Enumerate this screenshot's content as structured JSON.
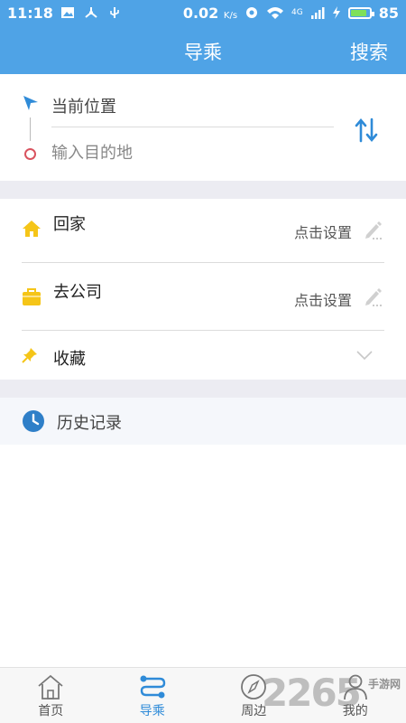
{
  "status_bar": {
    "time": "11:18",
    "speed": "0.02",
    "speed_unit": "K/s",
    "network": "4G",
    "battery": "85",
    "battery_level": 0.85,
    "battery_color": "#7ee05a"
  },
  "nav": {
    "title": "导乘",
    "search_label": "搜索",
    "color": "#4fa3e6"
  },
  "route": {
    "start_label": "当前位置",
    "destination_placeholder": "输入目的地",
    "start_icon": "navigation-arrow-icon",
    "end_icon": "destination-circle-icon",
    "swap_icon": "swap-arrows-icon"
  },
  "shortcuts": [
    {
      "label": "回家",
      "action": "点击设置",
      "icon": "home-icon",
      "action_icon": "pencil-icon"
    },
    {
      "label": "去公司",
      "action": "点击设置",
      "icon": "briefcase-icon",
      "action_icon": "pencil-icon"
    },
    {
      "label": "收藏",
      "icon": "pin-icon",
      "action_icon": "chevron-down-icon"
    }
  ],
  "history": {
    "label": "历史记录",
    "icon": "clock-icon"
  },
  "tabs": [
    {
      "label": "首页",
      "icon": "house-icon",
      "active": false
    },
    {
      "label": "导乘",
      "icon": "route-icon",
      "active": true
    },
    {
      "label": "周边",
      "icon": "compass-icon",
      "active": false
    },
    {
      "label": "我的",
      "icon": "user-icon",
      "active": false
    }
  ],
  "watermark": {
    "number": "2265",
    "text": "手游网"
  }
}
